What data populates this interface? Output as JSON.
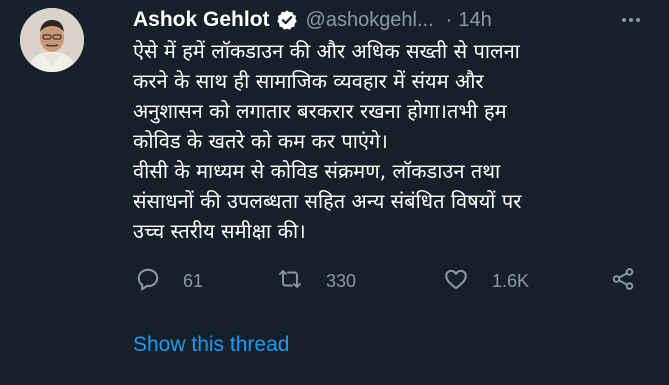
{
  "tweet": {
    "author_name": "Ashok Gehlot",
    "handle": "@ashokgehl...",
    "separator": "·",
    "time": "14h",
    "body_lines": [
      "ऐसे में हमें लॉकडाउन की और अधिक सख्ती से पालना",
      "करने के साथ ही सामाजिक व्यवहार में संयम और",
      "अनुशासन को लगातार बरकरार रखना होगा।तभी हम",
      "कोविड के खतरे को कम कर पाएंगे।",
      "वीसी के माध्यम से कोविड संक्रमण, लॉकडाउन तथा",
      "संसाधनों की उपलब्धता सहित अन्य संबंधित विषयों पर",
      "उच्च स्तरीय समीक्षा की।"
    ]
  },
  "actions": {
    "reply_count": "61",
    "retweet_count": "330",
    "like_count": "1.6K"
  },
  "thread_link": "Show this thread",
  "icons": [
    "verified-badge-icon",
    "more-icon",
    "reply-icon",
    "retweet-icon",
    "like-icon",
    "share-icon"
  ],
  "colors": {
    "background": "#15202b",
    "primary_text": "#ffffff",
    "secondary_text": "#8b98a5",
    "link": "#1d9bf0"
  }
}
